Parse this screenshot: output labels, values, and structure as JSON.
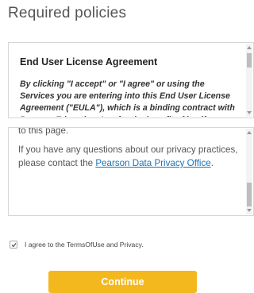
{
  "page": {
    "title": "Required policies"
  },
  "eula": {
    "heading": "End User License Agreement",
    "body": "By clicking \"I accept\" or \"I agree\" or using the Services you are entering into this End User License Agreement (\"EULA\"), which is a binding contract with Pearson Education, Inc. for the benefit of itself"
  },
  "privacy": {
    "line_top": "to this page.",
    "body_before_link": "If you have any questions about our privacy practices, please contact the ",
    "link_text": "Pearson Data Privacy Office",
    "body_after_link": "."
  },
  "agreement": {
    "checked": true,
    "label": "I agree to the TermsOfUse and Privacy."
  },
  "actions": {
    "continue_label": "Continue"
  },
  "colors": {
    "accent": "#f4b81f",
    "link": "#1a73b5"
  }
}
